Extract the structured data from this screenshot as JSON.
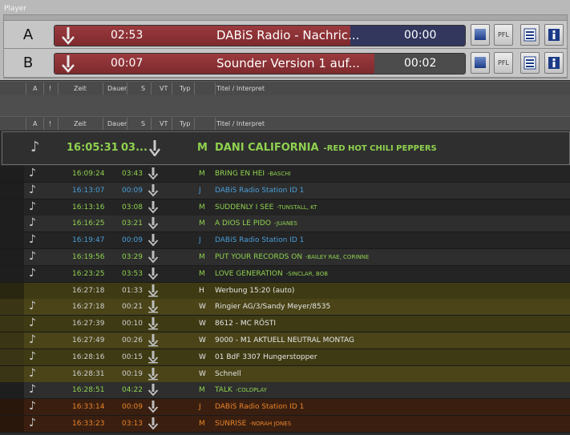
{
  "player": {
    "title": "Player",
    "decks": [
      {
        "letter": "A",
        "start": "02:53",
        "title": "DABiS Radio - Nachric...",
        "remaining": "00:00",
        "progress": 0.72,
        "pfl": "PFL"
      },
      {
        "letter": "B",
        "start": "00:07",
        "title": "Sounder Version 1 auf...",
        "remaining": "00:02",
        "progress": 0.78,
        "pfl": "PFL"
      }
    ]
  },
  "columns": [
    "A",
    "!",
    "Zeit",
    "Dauer",
    "S",
    "VT",
    "Typ",
    "Titel / Interpret"
  ],
  "current": {
    "time": "16:05:31",
    "duration": "03...",
    "type": "M",
    "title": "DANI CALIFORNIA",
    "artist": "-RED HOT CHILI PEPPERS"
  },
  "colors": {
    "music": "#8fd14f",
    "jingle": "#4a9fd8",
    "werbung_time": "#cfcfcf",
    "werbung_text": "#e6e6e6",
    "orange": "#e8842a",
    "row_dark": "#242424",
    "row_alt": "#2e2e2e",
    "row_werbung_a": "#3e3a13",
    "row_werbung_b": "#4a4418",
    "row_orange": "#3a1f10"
  },
  "rows": [
    {
      "time": "16:09:24",
      "duration": "03:43",
      "type": "M",
      "title": "BRING EN HEI",
      "artist": "-BASCHI",
      "kind": "music",
      "note": true
    },
    {
      "time": "16:13:07",
      "duration": "00:09",
      "type": "J",
      "title": "DABiS Radio Station ID 1",
      "artist": "",
      "kind": "jingle",
      "note": true
    },
    {
      "time": "16:13:16",
      "duration": "03:08",
      "type": "M",
      "title": "SUDDENLY I SEE",
      "artist": "-TUNSTALL, KT",
      "kind": "music",
      "note": true
    },
    {
      "time": "16:16:25",
      "duration": "03:21",
      "type": "M",
      "title": "A DIOS LE PIDO",
      "artist": "-JUANES",
      "kind": "music",
      "note": true
    },
    {
      "time": "16:19:47",
      "duration": "00:09",
      "type": "J",
      "title": "DABiS Radio Station ID 1",
      "artist": "",
      "kind": "jingle",
      "note": true
    },
    {
      "time": "16:19:56",
      "duration": "03:29",
      "type": "M",
      "title": "PUT YOUR RECORDS ON",
      "artist": "-BAILEY RAE, CORINNE",
      "kind": "music",
      "note": true
    },
    {
      "time": "16:23:25",
      "duration": "03:53",
      "type": "M",
      "title": "LOVE GENERATION",
      "artist": "-SINCLAR, BOB",
      "kind": "music",
      "note": true
    },
    {
      "time": "16:27:18",
      "duration": "01:33",
      "type": "H",
      "title": "Werbung 15:20 (auto)",
      "artist": "",
      "kind": "werbung_head",
      "note": false
    },
    {
      "time": "16:27:18",
      "duration": "00:21",
      "type": "W",
      "title": "Ringier AG/3/Sandy Meyer/8535",
      "artist": "",
      "kind": "werbung",
      "note": true
    },
    {
      "time": "16:27:39",
      "duration": "00:10",
      "type": "W",
      "title": "8612 - MC RÖSTI",
      "artist": "",
      "kind": "werbung",
      "note": true
    },
    {
      "time": "16:27:49",
      "duration": "00:26",
      "type": "W",
      "title": "9000 - M1 AKTUELL NEUTRAL MONTAG",
      "artist": "",
      "kind": "werbung",
      "note": true
    },
    {
      "time": "16:28:16",
      "duration": "00:15",
      "type": "W",
      "title": "01 BdF 3307 Hungerstopper",
      "artist": "",
      "kind": "werbung",
      "note": true
    },
    {
      "time": "16:28:31",
      "duration": "00:19",
      "type": "W",
      "title": "Schnell",
      "artist": "",
      "kind": "werbung",
      "note": true
    },
    {
      "time": "16:28:51",
      "duration": "04:22",
      "type": "M",
      "title": "TALK",
      "artist": "-COLDPLAY",
      "kind": "music",
      "note": true
    },
    {
      "time": "16:33:14",
      "duration": "00:09",
      "type": "J",
      "title": "DABiS Radio Station ID 1",
      "artist": "",
      "kind": "orange",
      "note": true
    },
    {
      "time": "16:33:23",
      "duration": "03:13",
      "type": "M",
      "title": "SUNRISE",
      "artist": "-NORAH JONES",
      "kind": "orange",
      "note": true
    }
  ]
}
